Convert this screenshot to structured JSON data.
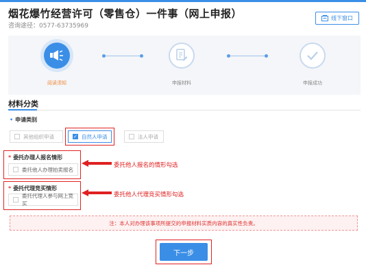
{
  "header": {
    "title": "烟花爆竹经营许可（零售仓）一件事（网上申报）",
    "consult": "咨询途径：0577-63735969",
    "offline_button": "线下窗口"
  },
  "steps": [
    {
      "label": "阅读须知",
      "state": "active",
      "icon": "megaphone-icon"
    },
    {
      "label": "申报材料",
      "state": "todo",
      "icon": "document-edit-icon"
    },
    {
      "label": "申报成功",
      "state": "todo",
      "icon": "check-circle-icon"
    }
  ],
  "section": {
    "title": "材料分类"
  },
  "apply_type": {
    "label": "申请类别",
    "options": [
      {
        "label": "其他组织申请",
        "checked": false
      },
      {
        "label": "自然人申请",
        "checked": true
      },
      {
        "label": "法人申请",
        "checked": false
      }
    ]
  },
  "agent_group": {
    "label": "委托办理人报名情形",
    "option": "委托他人办理拍卖报名"
  },
  "bidder_group": {
    "label": "委托代理竞买情形",
    "option": "委托代理人参与网上竞买"
  },
  "annotations": {
    "agent": "委托他人报名的情形勾选",
    "bidder": "委托他人代理竞买情形勾选"
  },
  "notice": "注：本人对办理该事项所提交的申报材料实质内容的真实性负责。",
  "next_button": "下一步",
  "colors": {
    "accent": "#3a8ee6",
    "warning": "#e02020",
    "step_active_label": "#f08a3c"
  }
}
